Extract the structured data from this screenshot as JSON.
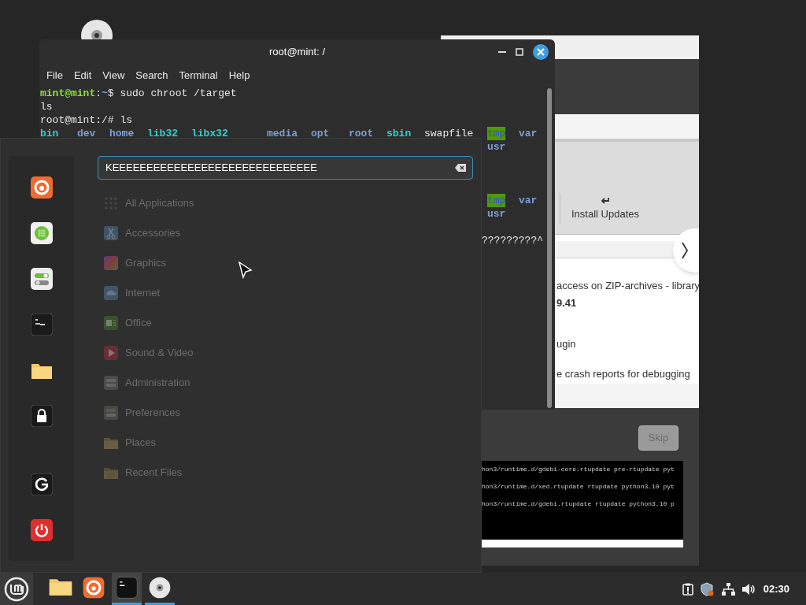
{
  "terminal": {
    "title": "root@mint: /",
    "menu": [
      "File",
      "Edit",
      "View",
      "Search",
      "Terminal",
      "Help"
    ],
    "lines": [
      {
        "kind": "prompt",
        "user": "mint@mint",
        "sep": ":",
        "path": "~",
        "symbol": "$",
        "command": "sudo chroot /target"
      },
      {
        "kind": "text",
        "text": "ls"
      },
      {
        "kind": "text",
        "text": "root@mint:/# ls"
      },
      {
        "kind": "ls",
        "entries": [
          {
            "name": "bin",
            "kind": "link"
          },
          {
            "name": "dev",
            "kind": "dir"
          },
          {
            "name": "home",
            "kind": "dir"
          },
          {
            "name": "lib32",
            "kind": "link"
          },
          {
            "name": "libx32",
            "kind": "link"
          },
          {
            "name": "media",
            "kind": "dir"
          },
          {
            "name": "opt",
            "kind": "dir"
          },
          {
            "name": "root",
            "kind": "dir"
          },
          {
            "name": "sbin",
            "kind": "link"
          },
          {
            "name": "swapfile",
            "kind": "file"
          },
          {
            "name": "tmp",
            "kind": "sticky"
          },
          {
            "name": "var",
            "kind": "dir"
          }
        ]
      },
      {
        "kind": "ls_wrap",
        "entries": [
          {
            "name": "usr",
            "kind": "dir"
          }
        ]
      }
    ],
    "covered_lines": [
      {
        "kind": "ls_wrap",
        "entries": [
          {
            "name": "tmp",
            "kind": "sticky"
          },
          {
            "name": "var",
            "kind": "dir"
          }
        ]
      },
      {
        "kind": "ls_wrap",
        "entries": [
          {
            "name": "usr",
            "kind": "dir"
          }
        ]
      },
      {
        "kind": "tail",
        "text": "?????????^"
      }
    ]
  },
  "installer": {
    "toolbar_button": "Install Updates",
    "package_texts": [
      {
        "text": "access on ZIP-archives - library",
        "bold": false
      },
      {
        "text": "9.41",
        "bold": true
      },
      {
        "text": "ugin",
        "bold": false
      },
      {
        "text": "e crash reports for debugging",
        "bold": false
      }
    ],
    "skip_button": {
      "label": "Skip",
      "disabled": true
    },
    "log": [
      "hon3/runtime.d/gdebi-core.rtupdate pre-rtupdate pyt",
      "hon3/runtime.d/xed.rtupdate rtupdate python3.10 pyt",
      "hon3/runtime.d/gdebi.rtupdate rtupdate python3.10 p"
    ]
  },
  "app_menu": {
    "search": {
      "value": "KEEEEEEEEEEEEEEEEEEEEEEEEEEEEEE"
    },
    "categories": [
      {
        "label": "All Applications",
        "disabled": true
      },
      {
        "label": "Accessories",
        "disabled": true
      },
      {
        "label": "Graphics",
        "disabled": true
      },
      {
        "label": "Internet",
        "disabled": true
      },
      {
        "label": "Office",
        "disabled": true
      },
      {
        "label": "Sound & Video",
        "disabled": true
      },
      {
        "label": "Administration",
        "disabled": true
      },
      {
        "label": "Preferences",
        "disabled": true
      },
      {
        "label": "Places",
        "disabled": true
      },
      {
        "label": "Recent Files",
        "disabled": true
      }
    ]
  },
  "taskbar": {
    "apps": [
      {
        "running": false,
        "active": false
      },
      {
        "running": false,
        "active": false
      },
      {
        "running": true,
        "active": true
      },
      {
        "running": true,
        "active": false
      }
    ],
    "clock": "02:30"
  }
}
